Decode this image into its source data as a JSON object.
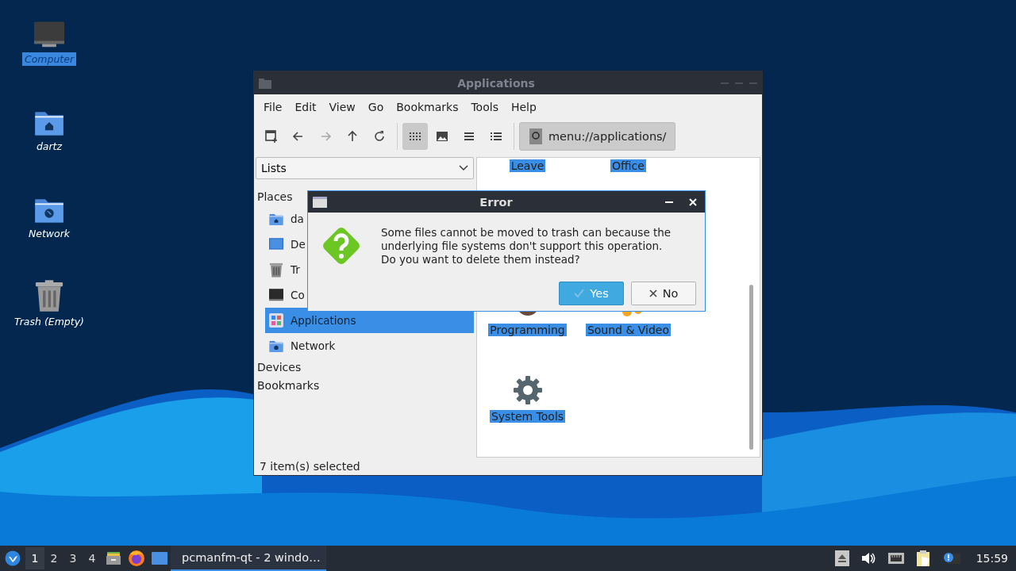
{
  "desktop_icons": [
    {
      "label": "Computer",
      "kind": "computer",
      "selected": true
    },
    {
      "label": "dartz",
      "kind": "home",
      "selected": false
    },
    {
      "label": "Network",
      "kind": "network",
      "selected": false
    },
    {
      "label": "Trash (Empty)",
      "kind": "trash",
      "selected": false
    }
  ],
  "window": {
    "title": "Applications",
    "menu": [
      "File",
      "Edit",
      "View",
      "Go",
      "Bookmarks",
      "Tools",
      "Help"
    ],
    "nav_buttons": [
      {
        "kind": "new-tab",
        "disabled": false
      },
      {
        "kind": "back",
        "disabled": false
      },
      {
        "kind": "forward",
        "disabled": true
      },
      {
        "kind": "up",
        "disabled": false
      },
      {
        "kind": "reload",
        "disabled": false
      }
    ],
    "view_modes": [
      {
        "kind": "icons",
        "selected": true
      },
      {
        "kind": "thumbnails",
        "selected": false
      },
      {
        "kind": "compact",
        "selected": false
      },
      {
        "kind": "details",
        "selected": false
      }
    ],
    "location": "menu://applications/",
    "side_pane": {
      "mode": "Lists",
      "sections": [
        {
          "label": "Places",
          "items": [
            {
              "label": "da",
              "kind": "home",
              "selected": false
            },
            {
              "label": "De",
              "kind": "desktop",
              "selected": false
            },
            {
              "label": "Tr",
              "kind": "trash",
              "selected": false
            },
            {
              "label": "Co",
              "kind": "computer",
              "selected": false
            },
            {
              "label": "Applications",
              "kind": "apps",
              "selected": true
            },
            {
              "label": "Network",
              "kind": "network",
              "selected": false
            }
          ]
        },
        {
          "label": "Devices"
        },
        {
          "label": "Bookmarks"
        }
      ]
    },
    "items": [
      {
        "label": "Leave",
        "kind": "hidden",
        "selected": true
      },
      {
        "label": "Office",
        "kind": "hidden",
        "selected": true
      },
      {
        "label": "Programming",
        "kind": "programming",
        "selected": true
      },
      {
        "label": "Sound & Video",
        "kind": "sound",
        "selected": true
      },
      {
        "label": "System Tools",
        "kind": "gear",
        "selected": true
      }
    ],
    "status": "7 item(s) selected"
  },
  "dialog": {
    "title": "Error",
    "message": "Some files cannot be moved to trash can because the underlying file systems don't support this operation. Do you want to delete them instead?",
    "buttons": [
      {
        "label": "Yes",
        "kind": "yes",
        "default": true
      },
      {
        "label": "No",
        "kind": "no",
        "default": false
      }
    ]
  },
  "taskbar": {
    "workspaces": [
      {
        "label": "1",
        "selected": true
      },
      {
        "label": "2",
        "selected": false
      },
      {
        "label": "3",
        "selected": false
      },
      {
        "label": "4",
        "selected": false
      }
    ],
    "launchers": [
      {
        "kind": "files"
      },
      {
        "kind": "browser"
      },
      {
        "kind": "desktop"
      }
    ],
    "task": {
      "label": "pcmanfm-qt - 2 windo…",
      "selected": true
    },
    "tray": [
      {
        "kind": "eject"
      },
      {
        "kind": "volume"
      },
      {
        "kind": "network"
      },
      {
        "kind": "clipboard"
      },
      {
        "kind": "notification"
      }
    ],
    "clock": "15:59"
  }
}
